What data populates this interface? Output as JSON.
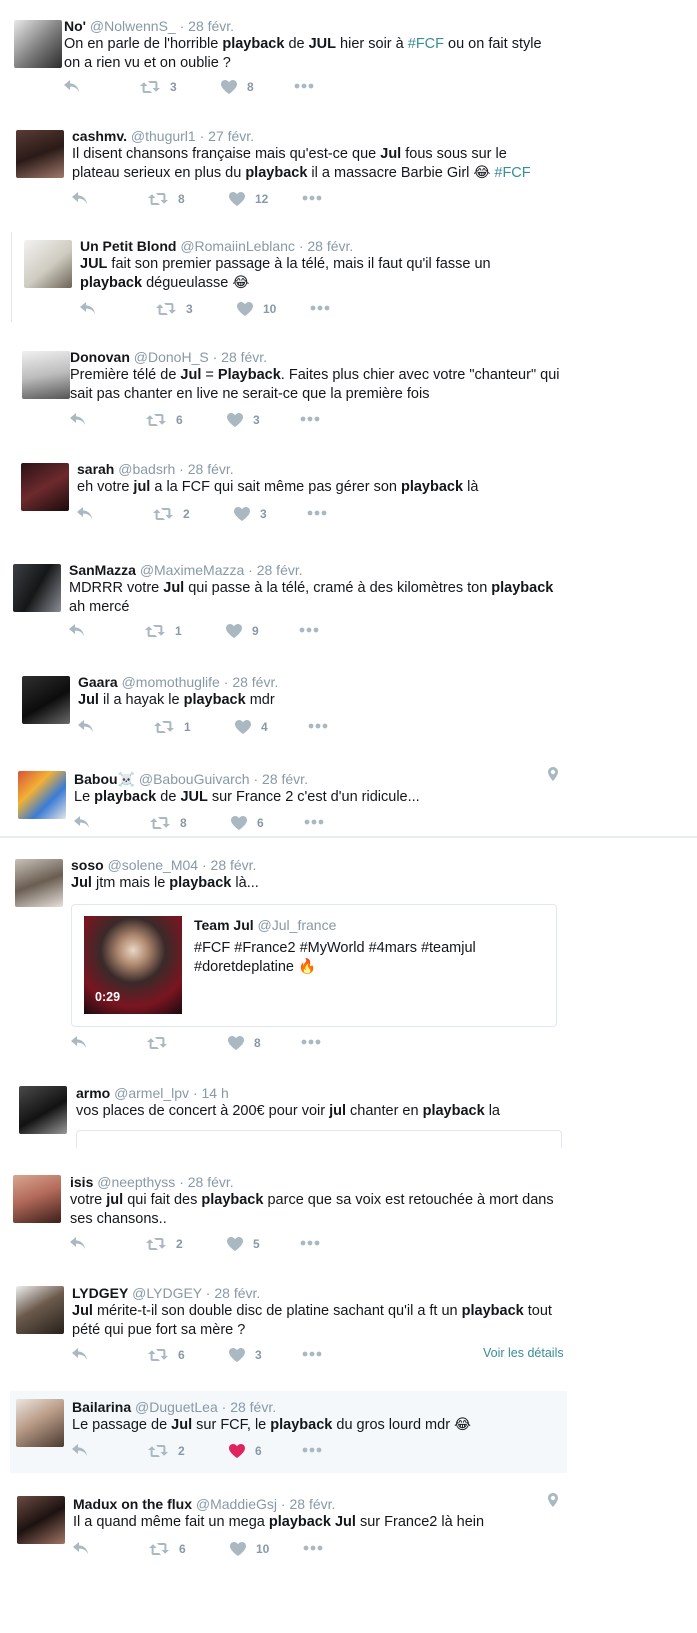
{
  "tweets": [
    {
      "name": "No'",
      "handle": "@NolwennS_",
      "time": "28 févr.",
      "segments": [
        {
          "t": "On en parle de l'horrible "
        },
        {
          "t": "playback",
          "b": true
        },
        {
          "t": " de "
        },
        {
          "t": "JUL",
          "b": true
        },
        {
          "t": " hier soir à "
        },
        {
          "t": "#FCF",
          "h": true
        },
        {
          "t": " ou on fait style on a rien vu et on oublie ?"
        }
      ],
      "retweets": "3",
      "likes": "8"
    },
    {
      "name": "cashmv.",
      "handle": "@thugurl1",
      "time": "27 févr.",
      "segments": [
        {
          "t": "Il disent chansons française mais qu'est-ce que "
        },
        {
          "t": "Jul",
          "b": true
        },
        {
          "t": " fous sous sur le plateau serieux en plus du "
        },
        {
          "t": "playback",
          "b": true
        },
        {
          "t": " il a massacre Barbie Girl 😂 "
        },
        {
          "t": "#FCF",
          "h": true
        }
      ],
      "retweets": "8",
      "likes": "12"
    },
    {
      "name": "Un Petit Blond",
      "handle": "@RomaiinLeblanc",
      "time": "28 févr.",
      "segments": [
        {
          "t": "JUL",
          "b": true
        },
        {
          "t": " fait son premier passage à la télé, mais il faut qu'il fasse un "
        },
        {
          "t": "playback",
          "b": true
        },
        {
          "t": " dégueulasse 😂"
        }
      ],
      "retweets": "3",
      "likes": "10"
    },
    {
      "name": "Donovan",
      "handle": "@DonoH_S",
      "time": "28 févr.",
      "segments": [
        {
          "t": "Première télé de "
        },
        {
          "t": "Jul",
          "b": true
        },
        {
          "t": " = "
        },
        {
          "t": "Playback",
          "b": true
        },
        {
          "t": ". Faites plus chier avec votre \"chanteur\" qui sait pas chanter en live ne serait-ce que la première fois"
        }
      ],
      "retweets": "6",
      "likes": "3"
    },
    {
      "name": "sarah",
      "handle": "@badsrh",
      "time": "28 févr.",
      "segments": [
        {
          "t": "eh votre "
        },
        {
          "t": "jul",
          "b": true
        },
        {
          "t": " a la FCF qui sait même pas gérer son "
        },
        {
          "t": "playback",
          "b": true
        },
        {
          "t": " là"
        }
      ],
      "retweets": "2",
      "likes": "3"
    },
    {
      "name": "SanMazza",
      "handle": "@MaximeMazza",
      "time": "28 févr.",
      "segments": [
        {
          "t": "MDRRR votre "
        },
        {
          "t": "Jul",
          "b": true
        },
        {
          "t": " qui passe à la télé, cramé à des kilomètres ton "
        },
        {
          "t": "playback",
          "b": true
        },
        {
          "t": " ah mercé"
        }
      ],
      "retweets": "1",
      "likes": "9"
    },
    {
      "name": "Gaara",
      "handle": "@momothuglife",
      "time": "28 févr.",
      "segments": [
        {
          "t": "Jul",
          "b": true
        },
        {
          "t": " il a hayak le "
        },
        {
          "t": "playback",
          "b": true
        },
        {
          "t": " mdr"
        }
      ],
      "retweets": "1",
      "likes": "4"
    },
    {
      "name": "Babou☠️",
      "handle": "@BabouGuivarch",
      "time": "28 févr.",
      "segments": [
        {
          "t": "Le "
        },
        {
          "t": "playback",
          "b": true
        },
        {
          "t": " de "
        },
        {
          "t": "JUL",
          "b": true
        },
        {
          "t": " sur France 2 c'est d'un ridicule..."
        }
      ],
      "retweets": "8",
      "likes": "6"
    },
    {
      "name": "soso",
      "handle": "@solene_M04",
      "time": "28 févr.",
      "segments": [
        {
          "t": "Jul",
          "b": true
        },
        {
          "t": " jtm mais le "
        },
        {
          "t": "playback",
          "b": true
        },
        {
          "t": " là..."
        }
      ],
      "retweets": "",
      "likes": "8",
      "quote": {
        "name": "Team Jul",
        "handle": "@Jul_france",
        "text": "#FCF #France2 #MyWorld #4mars #teamjul #doretdeplatine 🔥",
        "duration": "0:29"
      }
    },
    {
      "name": "armo",
      "handle": "@armel_lpv",
      "time": "14 h",
      "segments": [
        {
          "t": "vos places de concert à 200€ pour voir "
        },
        {
          "t": "jul",
          "b": true
        },
        {
          "t": " chanter en "
        },
        {
          "t": "playback",
          "b": true
        },
        {
          "t": " la"
        }
      ],
      "retweets": "",
      "likes": ""
    },
    {
      "name": "isis",
      "handle": "@neepthyss",
      "time": "28 févr.",
      "segments": [
        {
          "t": "votre "
        },
        {
          "t": "jul",
          "b": true
        },
        {
          "t": " qui fait des "
        },
        {
          "t": "playback",
          "b": true
        },
        {
          "t": " parce que sa voix est retouchée à mort dans ses chansons.."
        }
      ],
      "retweets": "2",
      "likes": "5"
    },
    {
      "name": "LYDGEY",
      "handle": "@LYDGEY",
      "time": "28 févr.",
      "segments": [
        {
          "t": "Jul",
          "b": true
        },
        {
          "t": " mérite-t-il son double disc de platine sachant qu'il a ft un "
        },
        {
          "t": "playback",
          "b": true
        },
        {
          "t": " tout pété qui pue fort sa mère ?"
        }
      ],
      "retweets": "6",
      "likes": "3",
      "details": "Voir les détails"
    },
    {
      "name": "Bailarina",
      "handle": "@DuguetLea",
      "time": "28 févr.",
      "segments": [
        {
          "t": "Le passage de "
        },
        {
          "t": "Jul",
          "b": true
        },
        {
          "t": " sur FCF, le "
        },
        {
          "t": "playback",
          "b": true
        },
        {
          "t": " du gros lourd mdr 😂"
        }
      ],
      "retweets": "2",
      "likes": "6"
    },
    {
      "name": "Madux on the flux",
      "handle": "@MaddieGsj",
      "time": "28 févr.",
      "segments": [
        {
          "t": "Il a quand même fait un mega "
        },
        {
          "t": "playback",
          "b": true
        },
        {
          "t": " "
        },
        {
          "t": "Jul",
          "b": true
        },
        {
          "t": " sur France2 là hein"
        }
      ],
      "retweets": "6",
      "likes": "10"
    }
  ],
  "colors": {
    "hashtag": "#3a8c97",
    "icon": "#aab8c2",
    "like_active": "#e0245e",
    "highlight_bg": "#f5f8fa"
  },
  "icons": {
    "reply": "reply-icon",
    "retweet": "retweet-icon",
    "like": "heart-icon",
    "more": "more-icon",
    "geo": "location-pin-icon",
    "video_play": "video-thumbnail"
  }
}
